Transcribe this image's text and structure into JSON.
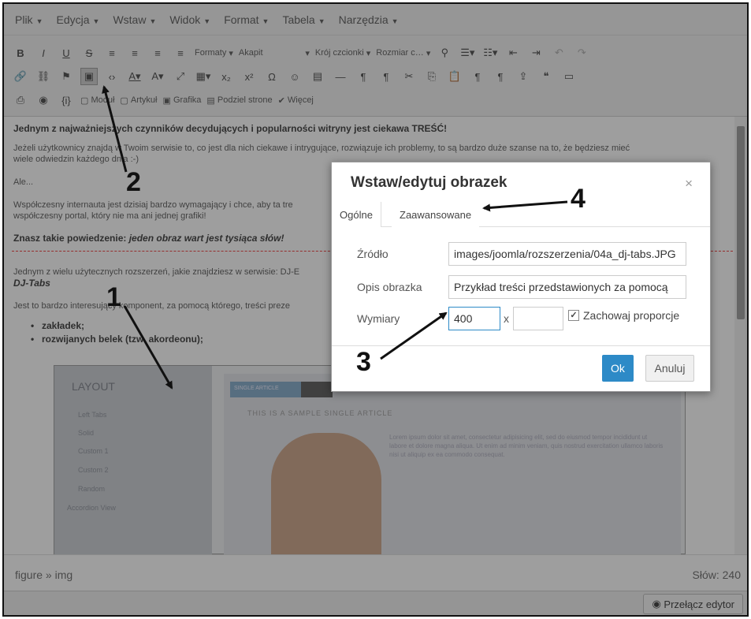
{
  "menu": [
    {
      "label": "Plik"
    },
    {
      "label": "Edycja"
    },
    {
      "label": "Wstaw"
    },
    {
      "label": "Widok"
    },
    {
      "label": "Format"
    },
    {
      "label": "Tabela"
    },
    {
      "label": "Narzędzia"
    }
  ],
  "toolbar": {
    "formats": "Formaty",
    "paragraph": "Akapit",
    "font": "Krój czcionki",
    "size": "Rozmiar c…",
    "module": "Moduł",
    "article": "Artykuł",
    "image": "Grafika",
    "pagebreak": "Podziel strone",
    "more": "Więcej"
  },
  "content": {
    "heading": "Jednym z najważniejszych czynników decydujących i popularności witryny jest ciekawa TREŚĆ!",
    "p1": "Jeżeli użytkownicy znajdą w Twoim serwisie to, co jest dla nich ciekawe i intrygujące, rozwiązuje ich problemy, to są bardzo duże szanse na to, że będziesz mieć",
    "p1b": "wiele odwiedzin każdego dnia :-)",
    "p2": "Ale...",
    "p3": "Współczesny internauta jest dzisiaj bardzo wymagający i chce, aby ta tre",
    "p3b": "współczesny portal, który nie ma ani jednej grafiki!",
    "quote_lead": "Znasz takie powiedzenie: ",
    "quote": "jeden obraz wart jest tysiąca słów!",
    "p4": "Jednym z wielu użytecznych rozszerzeń, jakie znajdziesz w serwisie: DJ-E",
    "p4b": "DJ-Tabs",
    "p5": "Jest to bardzo interesujący komponent, za pomocą którego, treści preze",
    "bullet1": "zakładek;",
    "bullet2": "rozwijanych belek (tzw. akordeonu);"
  },
  "preview": {
    "side_title": "LAYOUT",
    "side_items": [
      "Left Tabs",
      "Solid",
      "Custom 1",
      "Custom 2",
      "Random",
      "Accordion View"
    ],
    "tab_label": "SINGLE ARTICLE",
    "heading": "THIS IS A SAMPLE SINGLE ARTICLE",
    "text": "Lorem ipsum dolor sit amet, consectetur adipisicing elit, sed do eiusmod tempor incididunt ut labore et dolore magna aliqua. Ut enim ad minim veniam, quis nostrud exercitation ullamco laboris nisi ut aliquip ex ea commodo consequat."
  },
  "status": {
    "path": "figure » img",
    "wordcount": "Słów: 240"
  },
  "switch_editor": "Przełącz edytor",
  "dialog": {
    "title": "Wstaw/edytuj obrazek",
    "close": "×",
    "tabs": [
      "Ogólne",
      "Zaawansowane"
    ],
    "source_label": "Źródło",
    "source_value": "images/joomla/rozszerzenia/04a_dj-tabs.JPG",
    "alt_label": "Opis obrazka",
    "alt_value": "Przykład treści przedstawionych za pomocą",
    "dims_label": "Wymiary",
    "width": "400",
    "x": "x",
    "height": "",
    "keep_ratio": "Zachowaj proporcje",
    "ok": "Ok",
    "cancel": "Anuluj"
  },
  "callouts": [
    "1",
    "2",
    "3",
    "4"
  ]
}
